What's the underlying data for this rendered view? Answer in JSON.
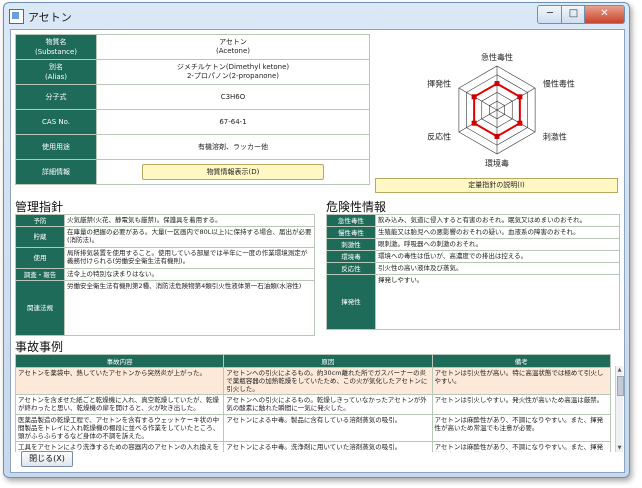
{
  "window": {
    "title": "アセトン",
    "close_glyph": "✕",
    "min_glyph": "─",
    "max_glyph": "□"
  },
  "basic": {
    "rows": [
      {
        "label": "物質名\n(Substance)",
        "value": "アセトン\n(Acetone)"
      },
      {
        "label": "別名\n(Alias)",
        "value": "ジメチルケトン(Dimethyl ketone)\n2-プロパノン(2-propanone)"
      },
      {
        "label": "分子式",
        "value": "C3H6O"
      },
      {
        "label": "CAS No.",
        "value": "67-64-1"
      },
      {
        "label": "使用用途",
        "value": "有機溶剤、ラッカー他"
      },
      {
        "label": "詳細情報",
        "value": ""
      }
    ],
    "info_button": "物質情報表示(D)"
  },
  "radar": {
    "axes": [
      "急性毒性",
      "慢性毒性",
      "刺激性",
      "環境毒",
      "反応性",
      "揮発性"
    ],
    "levels": 5,
    "values": [
      3,
      3,
      3,
      3,
      3,
      3
    ],
    "line_color": "#e00000",
    "point_color": "#cc0000",
    "level_button": "定量指針の説明(I)"
  },
  "management": {
    "title": "管理指針",
    "rows": [
      {
        "label": "予防",
        "text": "火気厳禁(火花、静電気も厳禁)。保護具を着用する。"
      },
      {
        "label": "貯蔵",
        "text": "在庫量の把握の必要がある。大量(一区画内で80L以上)に保持する場合、届出が必要(消防法)。"
      },
      {
        "label": "使用",
        "text": "局所排気装置を使用すること。使用している部屋では半年に一度の作業環境測定が義務付けられる(労働安全衛生法有機則)。"
      },
      {
        "label": "調査・報告",
        "text": "法令上の特別な決まりはない。"
      },
      {
        "label": "関連法規",
        "text": "労働安全衛生法有機則第2種、消防法危険物第4類引火性液体第一石油類(水溶性)"
      }
    ]
  },
  "hazard": {
    "title": "危険性情報",
    "rows": [
      {
        "label": "急性毒性",
        "text": "飲み込み、気道に侵入すると有害のおそれ。眠気又はめまいのおそれ。"
      },
      {
        "label": "慢性毒性",
        "text": "生殖能又は胎児への悪影響のおそれの疑い。血液系の障害のおそれ。"
      },
      {
        "label": "刺激性",
        "text": "眼刺激。呼吸器への刺激のおそれ。"
      },
      {
        "label": "環境毒",
        "text": "環境への毒性は低いが、高濃度での排出は控える。"
      },
      {
        "label": "反応性",
        "text": "引火性の高い液体及び蒸気。"
      },
      {
        "label": "揮発性",
        "text": "揮発しやすい。"
      }
    ]
  },
  "accidents": {
    "title": "事故事例",
    "headers": [
      "事故内容",
      "原因",
      "備考"
    ],
    "rows": [
      [
        "アセトンを薬袋中、熱していたアセトンから突然炎が上がった。",
        "アセトンへの引火によるもの。約30cm離れた所でガスバーナーの炎で薬瓶容器の加熱乾燥をしていたため、この火が気化したアセトンに引火した。",
        "アセトンは引火性が高い。特に高温状態では極めて引火しやすい。"
      ],
      [
        "アセトンを含ませた紙ごと乾燥機に入れ、真空乾燥していたが、乾燥が終わったと思い、乾燥機の扉を開けると、火が吹き出した。",
        "アセトンへの引火によるもの。乾燥しきっていなかったアセトンが外気の酸素に触れた瞬間に一気に発火した。",
        "アセトンは引火しやすい。発火性が高いため高温は厳禁。"
      ],
      [
        "医薬品製造の乾燥工程で、アセトンを含有するウェットケーキ状の中間製品をトレイに入れ乾燥機の棚段に並べる作業をしていたところ、頭がふらふらするなど身体の不調を訴えた。",
        "アセトンによる中毒。製品に含有している溶剤蒸気の吸引。",
        "アセトンは麻酔性があり、不調になりやすい。また、揮発性が高いため常温でも注意が必要。"
      ],
      [
        "工具をアセトンにより洗浄するための容器内のアセトンの入れ換えを行っていた際に中毒になった。",
        "アセトンによる中毒。洗浄剤に用いていた溶剤蒸気の吸引。",
        "アセトンは麻酔性があり、不調になりやすい。また、揮発性が高いため常温でも注意が必要。"
      ]
    ]
  },
  "close_button": "閉じる(X)"
}
